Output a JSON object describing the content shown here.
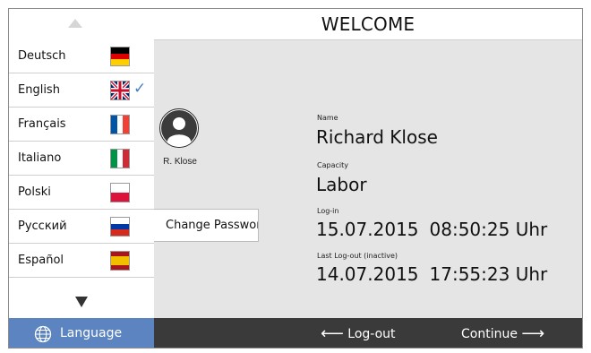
{
  "header": {
    "title": "WELCOME"
  },
  "user": {
    "avatar_caption": "R. Klose",
    "change_password_label": "Change Password",
    "name_label": "Name",
    "name_value": "Richard Klose",
    "capacity_label": "Capacity",
    "capacity_value": "Labor",
    "login_label": "Log-in",
    "login_date": "15.07.2015",
    "login_time": "08:50:25 Uhr",
    "last_logout_label": "Last Log-out (inactive)",
    "last_logout_date": "14.07.2015",
    "last_logout_time": "17:55:23 Uhr"
  },
  "languages": [
    {
      "label": "Deutsch",
      "flag": "flag-germany-icon"
    },
    {
      "label": "English",
      "flag": "flag-uk-icon",
      "selected": true
    },
    {
      "label": "Français",
      "flag": "flag-france-icon"
    },
    {
      "label": "Italiano",
      "flag": "flag-italy-icon"
    },
    {
      "label": "Polski",
      "flag": "flag-poland-icon"
    },
    {
      "label": "Русский",
      "flag": "flag-russia-icon"
    },
    {
      "label": "Español",
      "flag": "flag-spain-icon"
    }
  ],
  "footer": {
    "language_label": "Language",
    "logout_label": "Log-out",
    "continue_label": "Continue"
  },
  "colors": {
    "accent": "#5b84c0",
    "footer_bg": "#3a3a3a",
    "main_bg": "#e5e5e5",
    "check": "#4a7fc1"
  }
}
